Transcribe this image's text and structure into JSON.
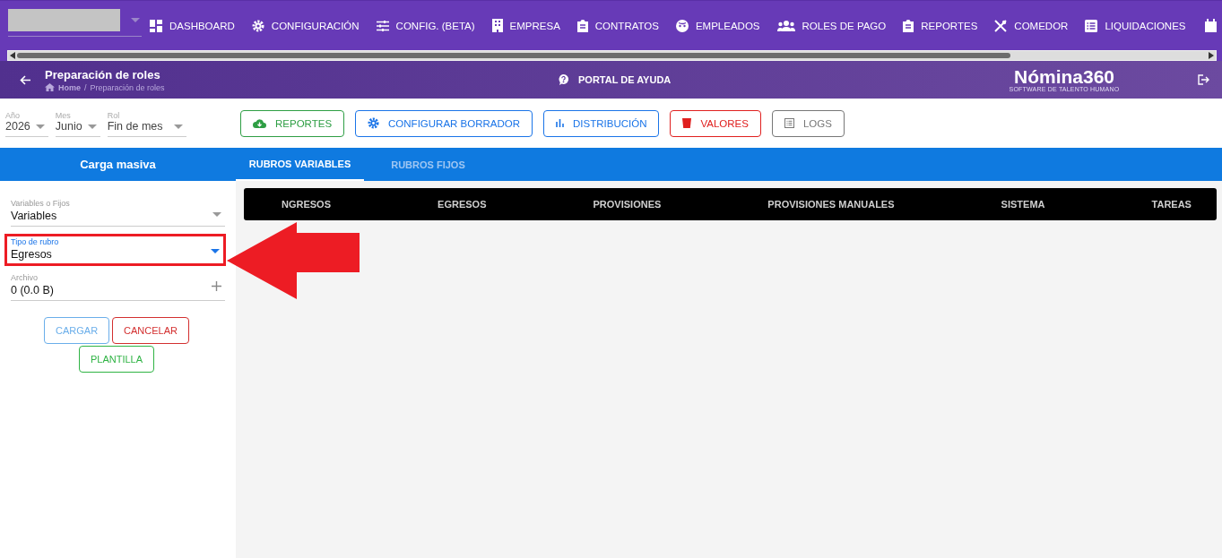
{
  "nav": {
    "items": [
      {
        "label": "DASHBOARD"
      },
      {
        "label": "CONFIGURACIÓN"
      },
      {
        "label": "CONFIG. (BETA)"
      },
      {
        "label": "EMPRESA"
      },
      {
        "label": "CONTRATOS"
      },
      {
        "label": "EMPLEADOS"
      },
      {
        "label": "ROLES DE PAGO"
      },
      {
        "label": "REPORTES"
      },
      {
        "label": "COMEDOR"
      },
      {
        "label": "LIQUIDACIONES"
      }
    ]
  },
  "page_header": {
    "title": "Preparación de roles",
    "breadcrumb": [
      "Home",
      "Preparación de roles"
    ],
    "breadcrumb_separator": "/",
    "help_link": "PORTAL DE AYUDA",
    "brand": {
      "name": "Nómina360",
      "tagline": "SOFTWARE DE TALENTO HUMANO"
    }
  },
  "filters": [
    {
      "label": "Año",
      "value": "2026"
    },
    {
      "label": "Mes",
      "value": "Junio"
    },
    {
      "label": "Rol",
      "value": "Fin de mes"
    }
  ],
  "actions": [
    {
      "label": "REPORTES",
      "color": "#2e9e44"
    },
    {
      "label": "CONFIGURAR BORRADOR",
      "color": "#1a74e8"
    },
    {
      "label": "DISTRIBUCIÓN",
      "color": "#1a74e8"
    },
    {
      "label": "VALORES",
      "color": "#e0201f"
    },
    {
      "label": "LOGS",
      "color": "#777777"
    }
  ],
  "side_panel": {
    "title": "Carga masiva",
    "fields": [
      {
        "kind": "select",
        "label": "Variables o Fijos",
        "value": "Variables",
        "focused": false
      },
      {
        "kind": "select",
        "label": "Tipo de rubro",
        "value": "Egresos",
        "focused": true
      },
      {
        "kind": "file",
        "label": "Archivo",
        "value": "0 (0.0 B)",
        "focused": false
      }
    ],
    "buttons": [
      {
        "label": "CARGAR",
        "color": "#6aaeea"
      },
      {
        "label": "CANCELAR",
        "color": "#d32f2f"
      },
      {
        "label": "PLANTILLA",
        "color": "#2fb344"
      }
    ]
  },
  "tabs": [
    {
      "label": "RUBROS VARIABLES",
      "selected": true
    },
    {
      "label": "RUBROS FIJOS",
      "selected": false
    }
  ],
  "table": {
    "columns": [
      "NGRESOS",
      "EGRESOS",
      "PROVISIONES",
      "PROVISIONES MANUALES",
      "SISTEMA",
      "TAREAS"
    ]
  }
}
